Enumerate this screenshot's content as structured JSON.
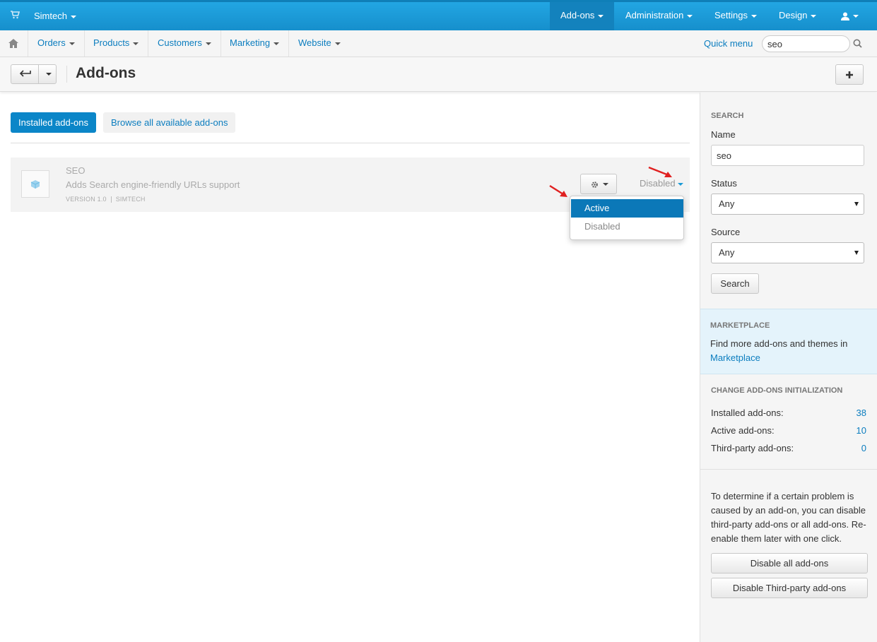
{
  "topbar": {
    "store": "Simtech",
    "menus": [
      "Add-ons",
      "Administration",
      "Settings",
      "Design"
    ]
  },
  "nav": {
    "items": [
      "Orders",
      "Products",
      "Customers",
      "Marketing",
      "Website"
    ],
    "quick_menu": "Quick menu",
    "search_value": "seo"
  },
  "page": {
    "title": "Add-ons"
  },
  "tabs": {
    "installed": "Installed add-ons",
    "browse": "Browse all available add-ons"
  },
  "addon": {
    "name": "SEO",
    "description": "Adds Search engine-friendly URLs support",
    "version": "VERSION 1.0",
    "vendor": "SIMTECH",
    "status": "Disabled"
  },
  "status_dropdown": {
    "active": "Active",
    "disabled": "Disabled"
  },
  "sidebar": {
    "search_heading": "SEARCH",
    "name_label": "Name",
    "name_value": "seo",
    "status_label": "Status",
    "status_value": "Any",
    "source_label": "Source",
    "source_value": "Any",
    "search_button": "Search",
    "marketplace_heading": "MARKETPLACE",
    "marketplace_text": "Find more add-ons and themes in",
    "marketplace_link": "Marketplace",
    "init_heading": "CHANGE ADD-ONS INITIALIZATION",
    "stats": [
      {
        "label": "Installed add-ons:",
        "value": "38"
      },
      {
        "label": "Active add-ons:",
        "value": "10"
      },
      {
        "label": "Third-party add-ons:",
        "value": "0"
      }
    ],
    "help_text": "To determine if a certain problem is caused by an add-on, you can disable third-party add-ons or all add-ons. Re-enable them later with one click.",
    "disable_all": "Disable all add-ons",
    "disable_third": "Disable Third-party add-ons"
  },
  "colors": {
    "topbar": "#1a9ad6",
    "link": "#0b7dbf",
    "primary_button": "#0b86c8",
    "arrow": "#e02020"
  }
}
